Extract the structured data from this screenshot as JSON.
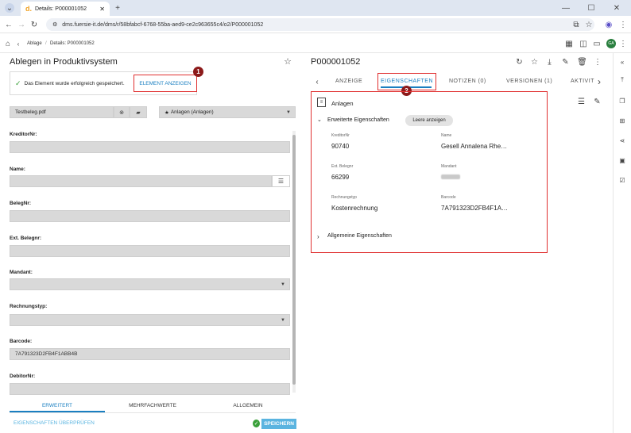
{
  "browser": {
    "tab_title": "Details: P000001052",
    "tab_logo": "d.",
    "url": "dms.fuersie-it.de/dms/r/58bfabcf-6768-55ba-aed9-ce2c963655c4/o2/P000001052"
  },
  "app_header": {
    "breadcrumb_root": "Ablage",
    "breadcrumb_current": "Details: P000001052",
    "avatar_initials": "GA"
  },
  "left": {
    "title": "Ablegen in Produktivsystem",
    "success_message": "Das Element wurde erfolgreich gespeichert.",
    "show_element_label": "ELEMENT ANZEIGEN",
    "marker1": "1",
    "file_name": "Testbeleg.pdf",
    "category": "Anlagen (Anlagen)",
    "fields": [
      {
        "label": "KreditorNr:",
        "value": ""
      },
      {
        "label": "Name:",
        "value": ""
      },
      {
        "label": "BelegNr:",
        "value": ""
      },
      {
        "label": "Ext. Belegnr:",
        "value": ""
      },
      {
        "label": "Mandant:",
        "value": ""
      },
      {
        "label": "Rechnungstyp:",
        "value": ""
      },
      {
        "label": "Barcode:",
        "value": "7A791323D2FB4F1ABB4B"
      },
      {
        "label": "DebitorNr:",
        "value": ""
      }
    ],
    "bottom_tabs": [
      "ERWEITERT",
      "MEHRFACHWERTE",
      "ALLGEMEIN"
    ],
    "check_props_label": "EIGENSCHAFTEN ÜBERPRÜFEN",
    "save_label": "SPEICHERN"
  },
  "right": {
    "doc_id": "P000001052",
    "tabs": [
      "ANZEIGE",
      "EIGENSCHAFTEN",
      "NOTIZEN (0)",
      "VERSIONEN (1)",
      "AKTIVIT"
    ],
    "active_tab": "EIGENSCHAFTEN",
    "marker2": "2",
    "section_title": "Anlagen",
    "extended_title": "Erweiterte Eigenschaften",
    "show_empty_label": "Leere anzeigen",
    "props": [
      {
        "label": "KreditorNr",
        "value": "90740"
      },
      {
        "label": "Name",
        "value": "Gesell Annalena Rhe…"
      },
      {
        "label": "Ext. Belegnr",
        "value": "66299"
      },
      {
        "label": "Mandant",
        "value": ""
      },
      {
        "label": "Rechnungstyp",
        "value": "Kostenrechnung"
      },
      {
        "label": "Barcode",
        "value": "7A791323D2FB4F1A…"
      }
    ],
    "general_title": "Allgemeine Eigenschaften"
  },
  "colors": {
    "accent": "#1a7fc1",
    "highlight": "#e03030",
    "marker": "#8c1a1a",
    "save": "#5ab4e0"
  }
}
